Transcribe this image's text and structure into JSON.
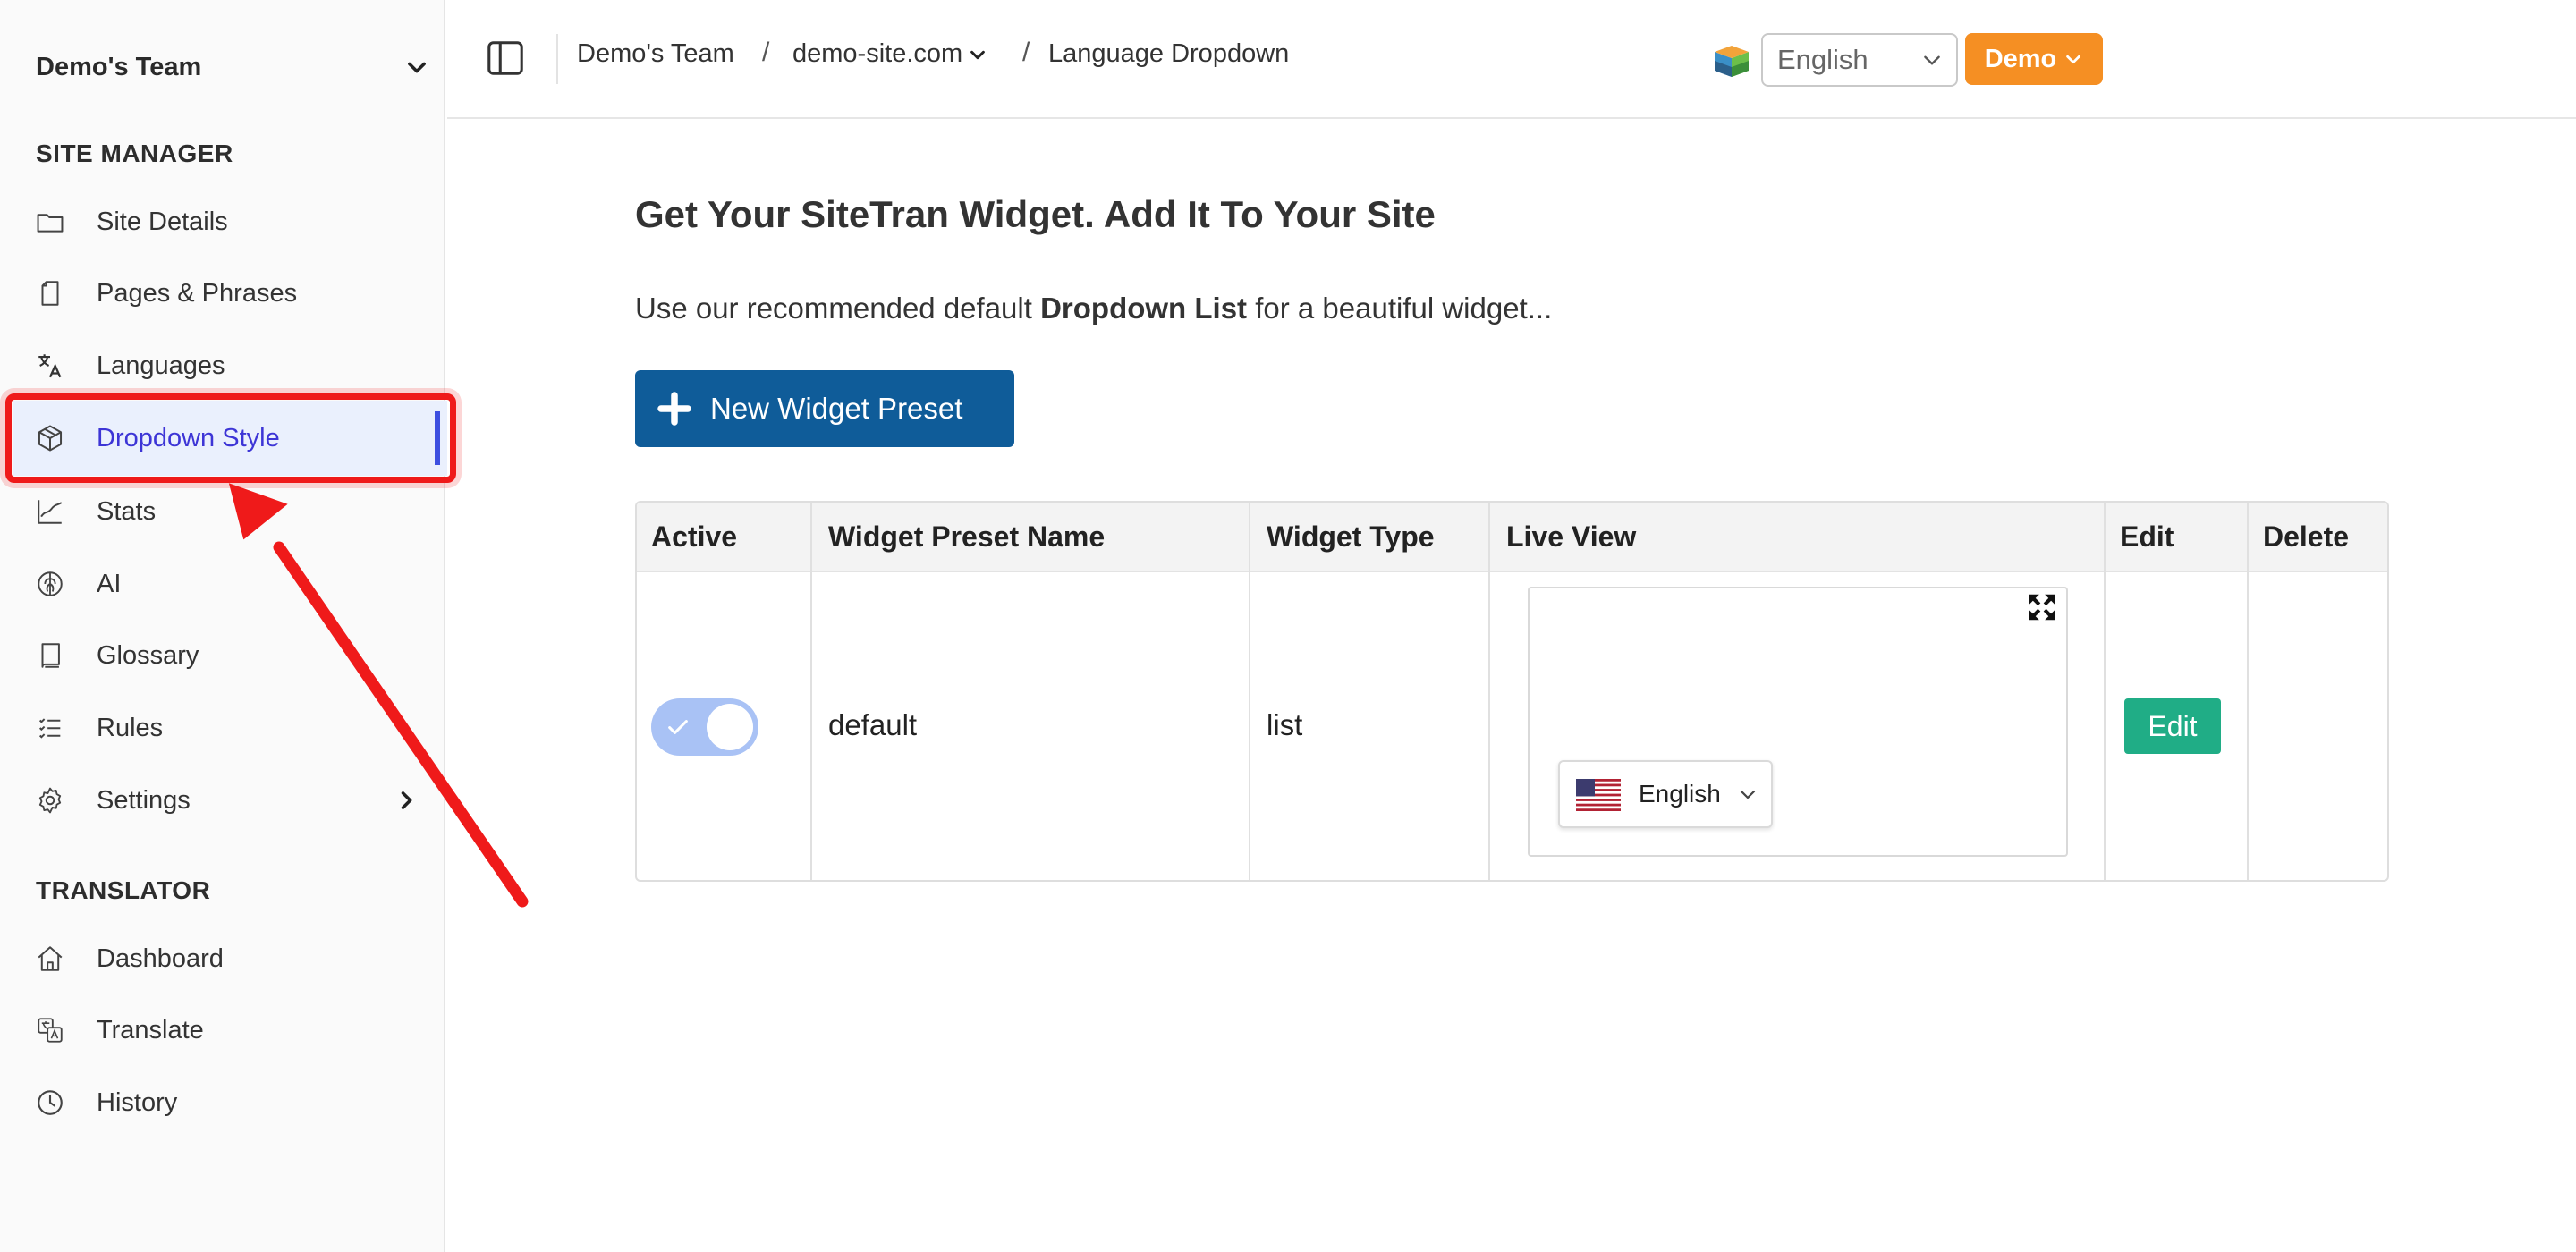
{
  "sidebar": {
    "team_name": "Demo's Team",
    "section_site_manager": "SITE MANAGER",
    "section_translator": "TRANSLATOR",
    "items": [
      {
        "label": "Site Details",
        "icon": "folder-icon"
      },
      {
        "label": "Pages & Phrases",
        "icon": "page-icon"
      },
      {
        "label": "Languages",
        "icon": "translate-icon"
      },
      {
        "label": "Dropdown Style",
        "icon": "cube-icon",
        "active": true
      },
      {
        "label": "Stats",
        "icon": "chart-line-icon"
      },
      {
        "label": "AI",
        "icon": "brain-icon"
      },
      {
        "label": "Glossary",
        "icon": "book-icon"
      },
      {
        "label": "Rules",
        "icon": "list-icon"
      },
      {
        "label": "Settings",
        "icon": "gear-icon"
      }
    ],
    "translator_items": [
      {
        "label": "Dashboard",
        "icon": "home-icon"
      },
      {
        "label": "Translate",
        "icon": "translate-doc-icon"
      },
      {
        "label": "History",
        "icon": "clock-icon"
      }
    ]
  },
  "header": {
    "breadcrumbs": [
      "Demo's Team",
      "demo-site.com",
      "Language Dropdown"
    ],
    "breadcrumb_separator": "/",
    "language_select": "English",
    "account_button": "Demo"
  },
  "main": {
    "heading": "Get Your SiteTran Widget. Add It To Your Site",
    "intro_prefix": "Use our recommended default ",
    "intro_bold": "Dropdown List",
    "intro_suffix": " for a beautiful widget...",
    "new_preset_button": "New Widget Preset"
  },
  "table": {
    "columns": [
      "Active",
      "Widget Preset Name",
      "Widget Type",
      "Live View",
      "Edit",
      "Delete"
    ],
    "rows": [
      {
        "active": true,
        "name": "default",
        "type": "list",
        "live_view_language": "English",
        "edit_label": "Edit"
      }
    ]
  },
  "colors": {
    "accent": "#3d35d6",
    "primary_button": "#0f5c99",
    "demo_button": "#f58f23",
    "edit_button": "#20ad86",
    "annotation": "#ef1a1a",
    "toggle_on": "#a9c2f5"
  }
}
